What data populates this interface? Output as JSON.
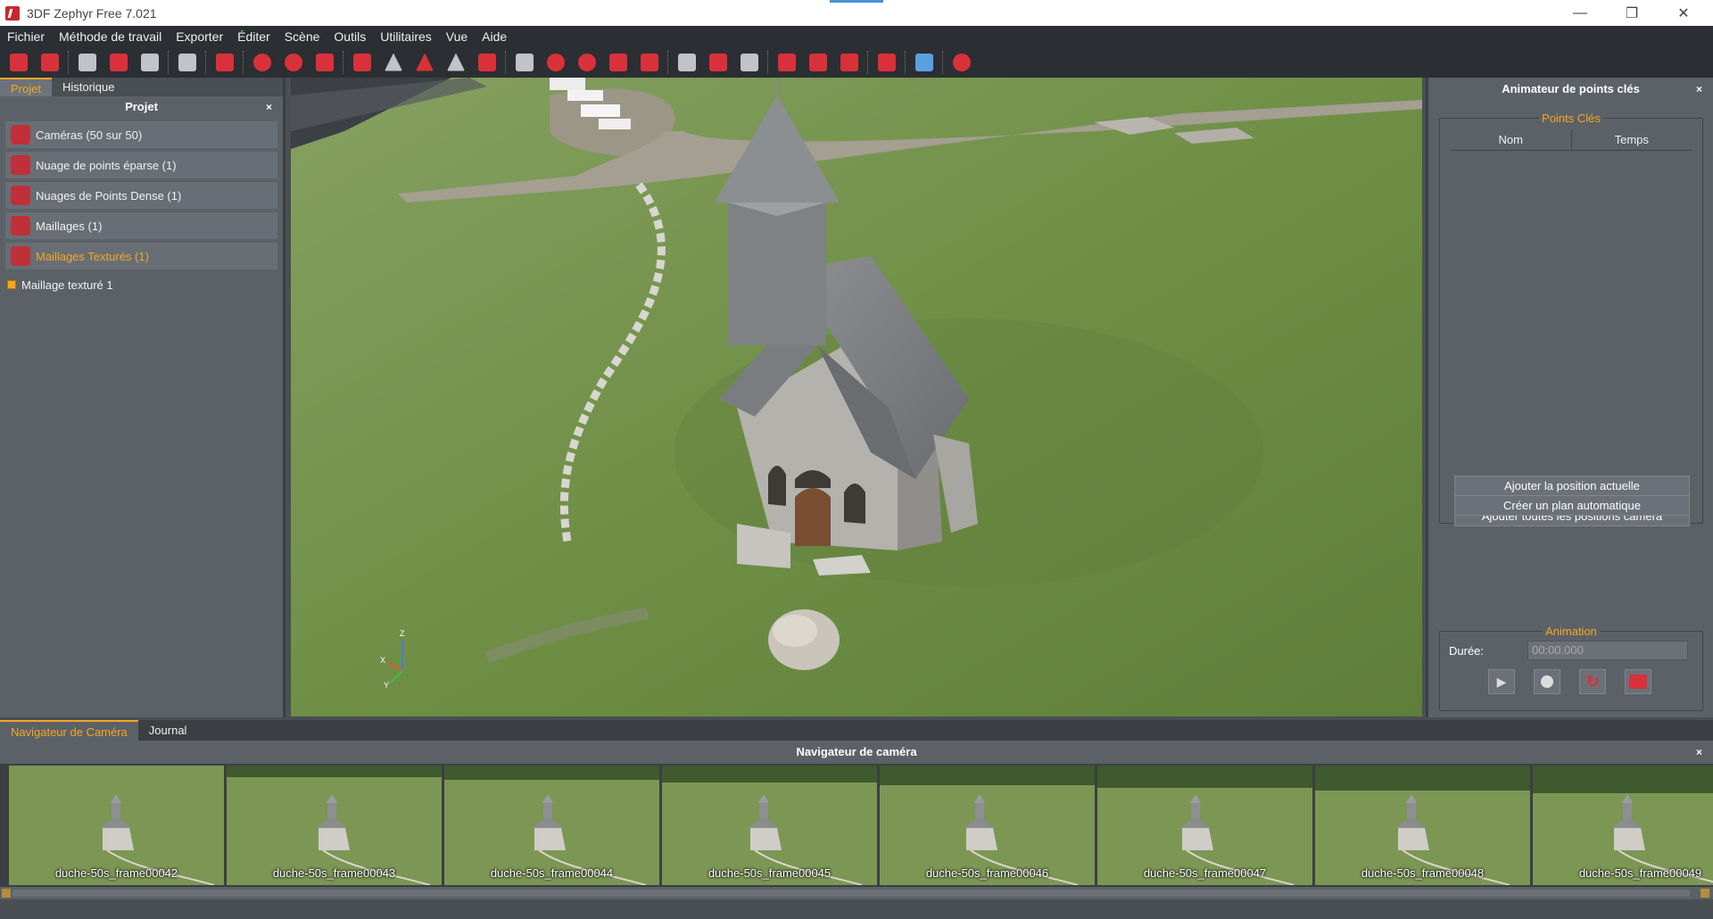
{
  "window": {
    "title": "3DF Zephyr Free 7.021"
  },
  "menu": [
    "Fichier",
    "Méthode de travail",
    "Exporter",
    "Éditer",
    "Scène",
    "Outils",
    "Utilitaires",
    "Vue",
    "Aide"
  ],
  "toolbar_icons": [
    {
      "name": "open-project-icon",
      "color": "#d9313a"
    },
    {
      "name": "save-project-icon",
      "color": "#d9313a"
    },
    "sep",
    {
      "name": "workflow-icon",
      "color": "#c0c4c8"
    },
    {
      "name": "mesh-cube-icon",
      "color": "#d9313a"
    },
    {
      "name": "mesh-wire-icon",
      "color": "#c0c4c8"
    },
    "sep",
    {
      "name": "texture-mesh-icon",
      "color": "#c0c4c8"
    },
    "sep",
    {
      "name": "camera-icon",
      "color": "#d9313a"
    },
    "sep",
    {
      "name": "selection-circle-icon",
      "color": "#d9313a"
    },
    {
      "name": "target-icon",
      "color": "#d9313a"
    },
    {
      "name": "cluster-icon",
      "color": "#d9313a"
    },
    "sep",
    {
      "name": "pin-icon",
      "color": "#d9313a"
    },
    {
      "name": "triangle-gray-icon",
      "color": "#c0c4c8"
    },
    {
      "name": "triangle-red-icon",
      "color": "#d9313a"
    },
    {
      "name": "triangle-outline-icon",
      "color": "#c0c4c8"
    },
    {
      "name": "brush-icon",
      "color": "#d9313a"
    },
    "sep",
    {
      "name": "scene-camera-icon",
      "color": "#c0c4c8"
    },
    {
      "name": "sphere-dots-icon",
      "color": "#d9313a"
    },
    {
      "name": "globe-icon",
      "color": "#d9313a"
    },
    {
      "name": "red-cube-icon",
      "color": "#d9313a"
    },
    {
      "name": "grid-cube-icon",
      "color": "#d9313a"
    },
    "sep",
    {
      "name": "render-screen-icon",
      "color": "#c0c4c8"
    },
    {
      "name": "undo-icon",
      "color": "#d9313a"
    },
    {
      "name": "redo-icon",
      "color": "#c0c4c8"
    },
    "sep",
    {
      "name": "orbit-icon",
      "color": "#d9313a"
    },
    {
      "name": "crop-icon",
      "color": "#d9313a"
    },
    {
      "name": "ruler-icon",
      "color": "#d9313a"
    },
    "sep",
    {
      "name": "settings-gear-icon",
      "color": "#d9313a"
    },
    "sep",
    {
      "name": "view-cube-icon",
      "color": "#5aa0e0"
    },
    "sep",
    {
      "name": "help-icon",
      "color": "#d9313a"
    }
  ],
  "left_panel": {
    "tabs": [
      "Projet",
      "Historique"
    ],
    "title": "Projet",
    "close": "×",
    "items": [
      {
        "label": "Caméras (50 sur 50)",
        "active": false
      },
      {
        "label": "Nuage de points éparse (1)",
        "active": false
      },
      {
        "label": "Nuages de Points Dense (1)",
        "active": false
      },
      {
        "label": "Maillages (1)",
        "active": false
      },
      {
        "label": "Maillages Texturés (1)",
        "active": true
      }
    ],
    "subitem": "Maillage texturé 1"
  },
  "right_panel": {
    "title": "Animateur de points clés",
    "close": "×",
    "keypoints_group": "Points Clés",
    "columns": [
      "Nom",
      "Temps"
    ],
    "buttons": [
      "Ajouter la position actuelle",
      "Ajouter toutes les positions caméra",
      "Créer un plan automatique"
    ],
    "animation_group": "Animation",
    "duration_label": "Durée:",
    "duration_value": "00:00.000"
  },
  "viewport": {
    "axis_labels": {
      "z": "Z",
      "x": "X",
      "y": "Y"
    }
  },
  "bottom": {
    "tabs": [
      "Navigateur de Caméra",
      "Journal"
    ],
    "title": "Navigateur de caméra",
    "close": "×",
    "frames": [
      "duche-50s_frame00042",
      "duche-50s_frame00043",
      "duche-50s_frame00044",
      "duche-50s_frame00045",
      "duche-50s_frame00046",
      "duche-50s_frame00047",
      "duche-50s_frame00048",
      "duche-50s_frame00049"
    ]
  }
}
